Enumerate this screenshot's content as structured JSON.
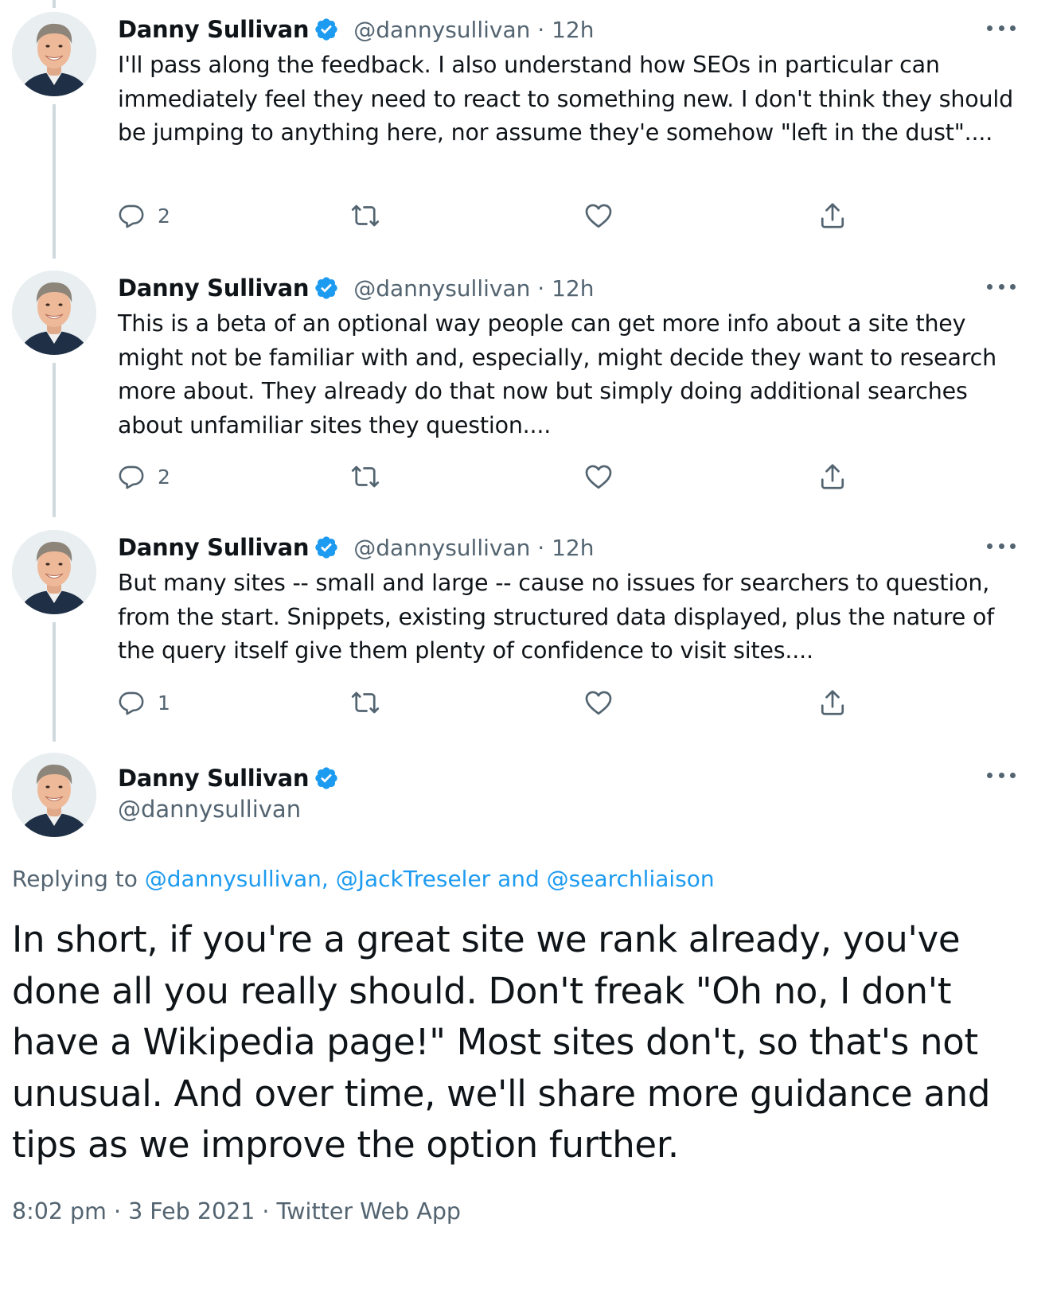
{
  "colors": {
    "text": "#0f1419",
    "secondary": "#536471",
    "accent": "#1d9bf0",
    "thread_line": "#cfd9de"
  },
  "thread": [
    {
      "name": "Danny Sullivan",
      "handle": "@dannysullivan",
      "time": "12h",
      "text": "I'll pass along the feedback. I also understand how SEOs in particular can immediately feel they need to react to something new. I don't think they should be jumping to anything here, nor assume they'e somehow \"left in the dust\"....",
      "reply_count": "2"
    },
    {
      "name": "Danny Sullivan",
      "handle": "@dannysullivan",
      "time": "12h",
      "text": "This is a beta of an optional way people can get more info about a site they might not be familiar with and, especially, might decide they want to research more about. They already do that now but simply doing additional searches about unfamiliar sites they question....",
      "reply_count": "2"
    },
    {
      "name": "Danny Sullivan",
      "handle": "@dannysullivan",
      "time": "12h",
      "text": "But many sites -- small and large -- cause no issues for searchers to question, from the start. Snippets, existing structured data displayed, plus the nature of the query itself give them plenty of confidence to visit sites....",
      "reply_count": "1"
    }
  ],
  "main_tweet": {
    "name": "Danny Sullivan",
    "handle": "@dannysullivan",
    "replying_prefix": "Replying to ",
    "replying_mention_1": "@dannysullivan",
    "replying_sep": ", ",
    "replying_mention_2": "@JackTreseler",
    "replying_and": " and ",
    "replying_mention_3": "@searchliaison",
    "text": "In short, if you're a great site we rank already, you've done all you really should. Don't freak \"Oh no, I don't have a Wikipedia page!\" Most sites don't, so that's not unusual. And over time, we'll share more guidance and tips as we improve the option further.",
    "time": "8:02 pm",
    "dot": " · ",
    "date": "3 Feb 2021",
    "source": "Twitter Web App"
  },
  "icons": {
    "reply": "reply-icon",
    "retweet": "retweet-icon",
    "like": "heart-icon",
    "share": "share-icon",
    "verified": "verified-badge-icon",
    "more": "more-icon"
  }
}
